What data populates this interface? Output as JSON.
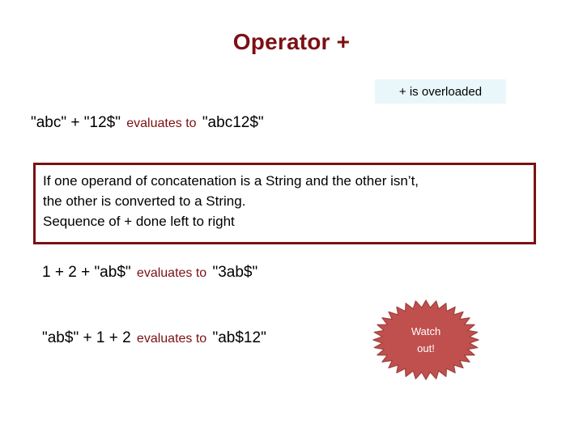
{
  "slide": {
    "title": "Operator +",
    "title_color": "#7B1113",
    "background_color": "#ffffff"
  },
  "callout": {
    "text": "+ is overloaded",
    "background_color": "#EAF7FA"
  },
  "expressions": [
    {
      "left": "\"abc\" + \"12$\"",
      "relation": "evaluates to",
      "right": "\"abc12$\""
    },
    {
      "left": "1 + 2  + \"ab$\"",
      "relation": "evaluates to",
      "right": "\"3ab$\""
    },
    {
      "left": "\"ab$\" + 1 + 2",
      "relation": "evaluates to",
      "right": "\"ab$12\""
    }
  ],
  "rule_box": {
    "border_color": "#7B1113",
    "lines": [
      "If one operand of concatenation is a String and the other isn’t,",
      "the other is converted to a String.",
      "Sequence of + done left to right"
    ]
  },
  "starburst": {
    "fill_color": "#C0504D",
    "stroke_color": "#9E403D",
    "line1": "Watch",
    "line2": "out!",
    "points": 32
  }
}
